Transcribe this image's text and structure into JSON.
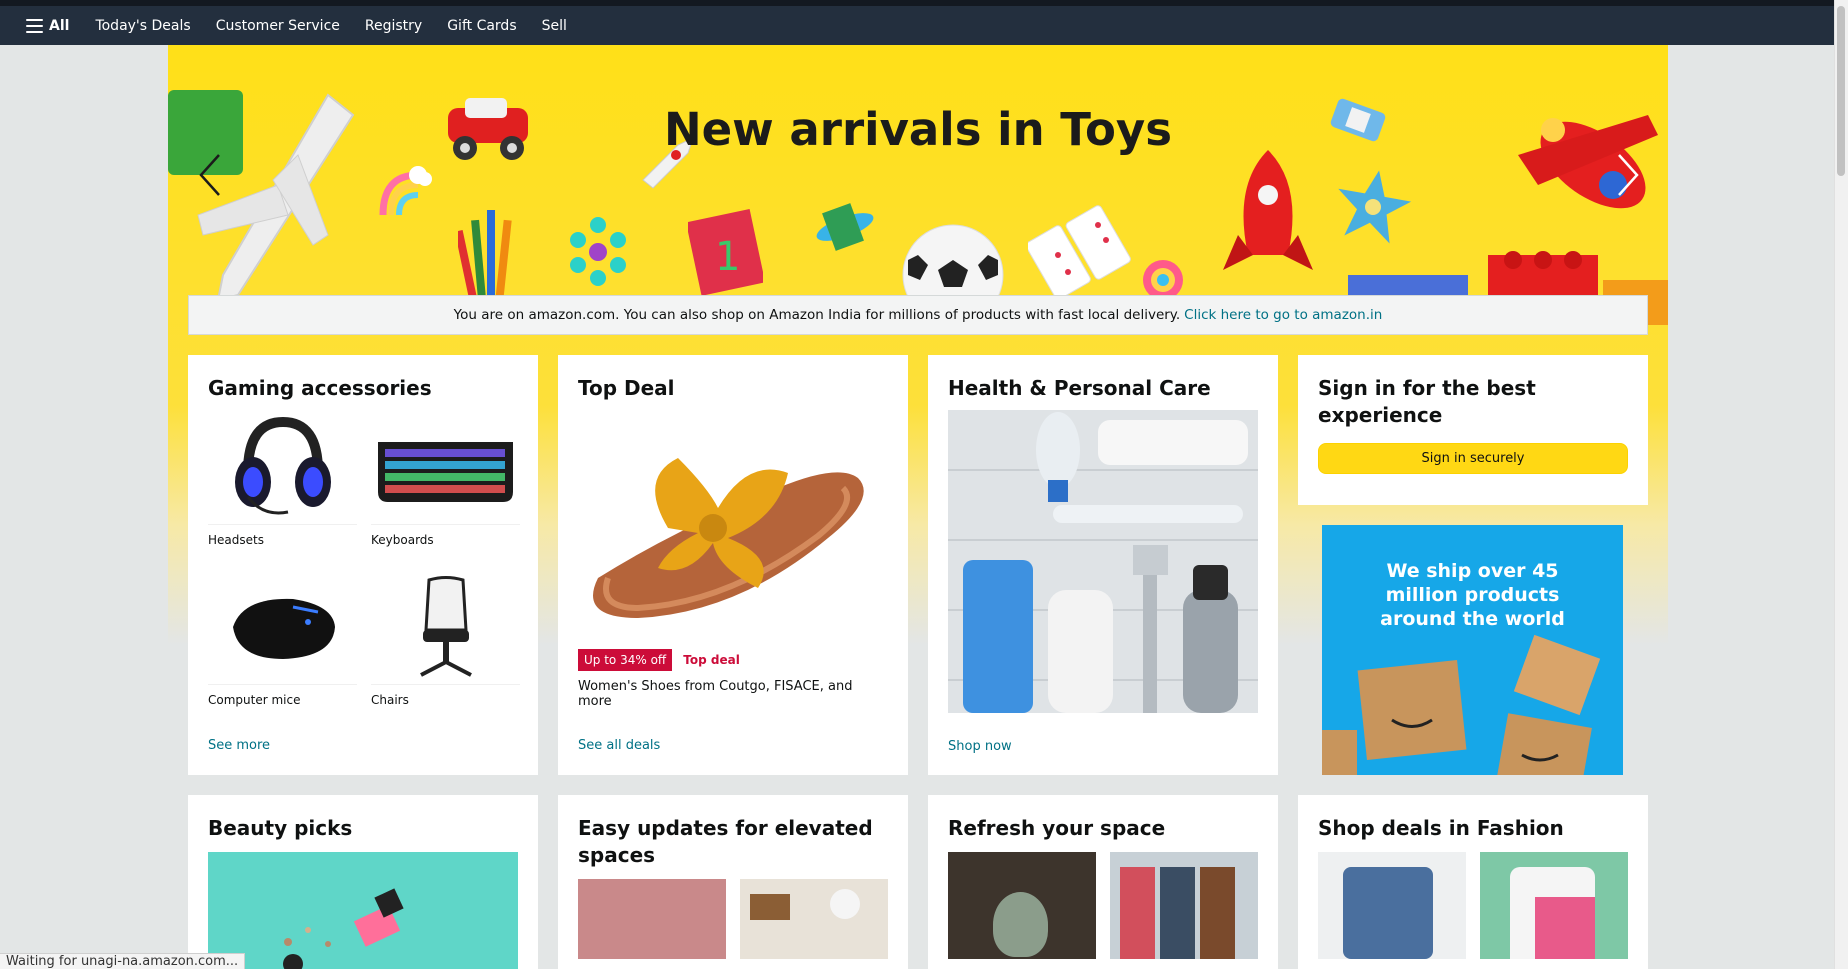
{
  "nav": {
    "all_label": "All",
    "links": [
      "Today's Deals",
      "Customer Service",
      "Registry",
      "Gift Cards",
      "Sell"
    ]
  },
  "hero": {
    "title": "New arrivals in Toys",
    "prev_icon": "chevron-left-icon",
    "next_icon": "chevron-right-icon"
  },
  "notice": {
    "text": "You are on amazon.com. You can also shop on Amazon India for millions of products with fast local delivery.",
    "link": "Click here to go to amazon.in"
  },
  "gaming": {
    "title": "Gaming accessories",
    "items": [
      "Headsets",
      "Keyboards",
      "Computer mice",
      "Chairs"
    ],
    "link": "See more"
  },
  "top_deal": {
    "title": "Top Deal",
    "badge": "Up to 34% off",
    "tag": "Top deal",
    "description": "Women's Shoes from Coutgo, FISACE, and more",
    "link": "See all deals"
  },
  "health": {
    "title": "Health & Personal Care",
    "link": "Shop now"
  },
  "signin": {
    "title": "Sign in for the best experience",
    "button": "Sign in securely"
  },
  "ad": {
    "text": "We ship over 45 million products around the world"
  },
  "row2": {
    "beauty": "Beauty picks",
    "easy": "Easy updates for elevated spaces",
    "refresh": "Refresh your space",
    "fashion": "Shop deals in Fashion"
  },
  "status": "Waiting for unagi-na.amazon.com...",
  "colors": {
    "nav_bg": "#232f3e",
    "hero_yellow": "#ffe018",
    "link": "#007185",
    "deal_red": "#cc0c39",
    "signin_yellow": "#ffd814"
  }
}
